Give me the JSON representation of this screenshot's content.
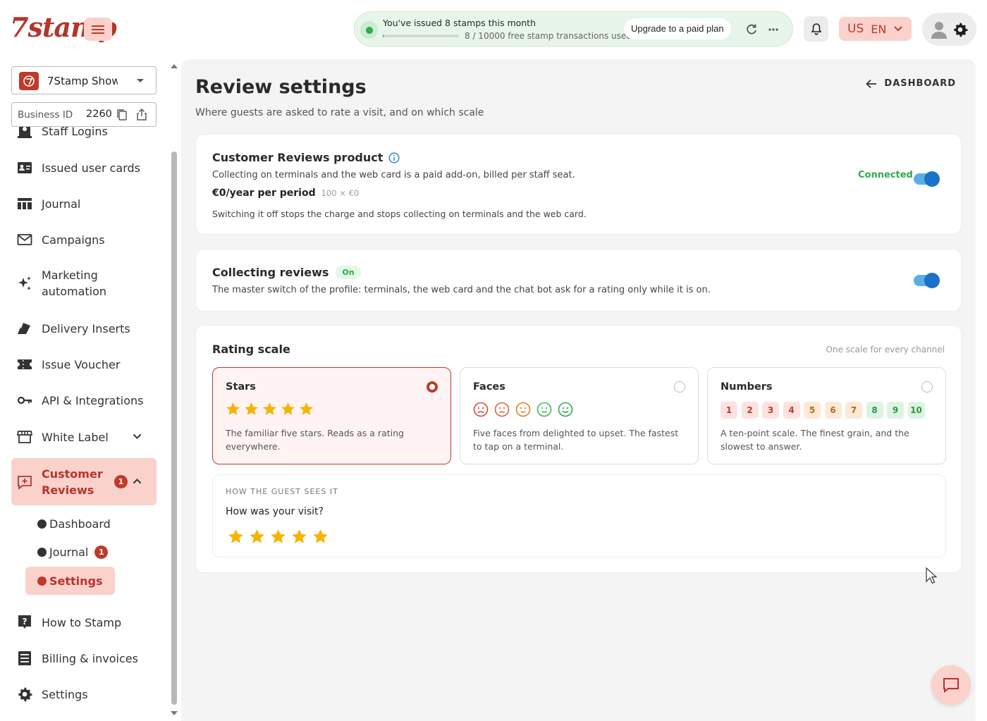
{
  "brand": {
    "logo_text": "7stamp"
  },
  "header": {
    "promo_title": "You've issued 8 stamps this month",
    "promo_progress": 0.0008,
    "promo_subtitle": "8 / 10000 free stamp transactions used",
    "upgrade_label": "Upgrade to a paid plan",
    "lang_country": "US",
    "lang_code": "EN"
  },
  "sidebar": {
    "business_name": "7Stamp Show",
    "business_id_label": "Business ID",
    "business_id": "2260",
    "items": [
      {
        "label": "Staff Logins",
        "icon": "staff-icon"
      },
      {
        "label": "Issued user cards",
        "icon": "user-card-icon"
      },
      {
        "label": "Journal",
        "icon": "journal-icon"
      },
      {
        "label": "Campaigns",
        "icon": "mail-icon"
      },
      {
        "label": "Marketing\nautomation",
        "icon": "sparkle-icon"
      },
      {
        "label": "Delivery Inserts",
        "icon": "insert-icon"
      },
      {
        "label": "Issue Voucher",
        "icon": "voucher-icon"
      },
      {
        "label": "API & Integrations",
        "icon": "key-icon"
      },
      {
        "label": "White Label",
        "icon": "storefront-icon"
      }
    ],
    "customer_reviews": {
      "label": "Customer\nReviews",
      "badge": "1"
    },
    "sub_items": [
      {
        "label": "Dashboard"
      },
      {
        "label": "Journal",
        "badge": "1"
      },
      {
        "label": "Settings"
      }
    ],
    "bottom_items": [
      {
        "label": "How to Stamp",
        "icon": "help-icon"
      },
      {
        "label": "Billing & invoices",
        "icon": "billing-icon"
      },
      {
        "label": "Settings",
        "icon": "gear-icon"
      }
    ]
  },
  "page": {
    "title": "Review settings",
    "subtitle": "Where guests are asked to rate a visit, and on which scale",
    "dashboard_link": "DASHBOARD"
  },
  "product_card": {
    "title": "Customer Reviews product",
    "description": "Collecting on terminals and the web card is a paid add-on, billed per staff seat.",
    "price": "€0/year per period",
    "price_detail": "100 × €0",
    "note": "Switching it off stops the charge and stops collecting on terminals and the web card.",
    "status": "Connected",
    "enabled": true
  },
  "collecting_card": {
    "title": "Collecting reviews",
    "badge": "On",
    "description": "The master switch of the profile: terminals, the web card and the chat bot ask for a rating only while it is on.",
    "enabled": true
  },
  "rating_card": {
    "title": "Rating scale",
    "hint": "One scale for every channel",
    "selected": "stars",
    "options": [
      {
        "name": "Stars",
        "description": "The familiar five stars. Reads as a rating everywhere."
      },
      {
        "name": "Faces",
        "description": "Five faces from delighted to upset. The fastest to tap on a terminal."
      },
      {
        "name": "Numbers",
        "description": "A ten-point scale. The finest grain, and the slowest to answer.",
        "values": [
          "1",
          "2",
          "3",
          "4",
          "5",
          "6",
          "7",
          "8",
          "9",
          "10"
        ]
      }
    ],
    "preview_label": "HOW THE GUEST SEES IT",
    "preview_question": "How was your visit?"
  },
  "colors": {
    "accent": "#c0392b",
    "accent_soft": "#fbd1cc",
    "star": "#f5b400",
    "toggle": "#1a73c7",
    "success": "#2faa4c"
  }
}
